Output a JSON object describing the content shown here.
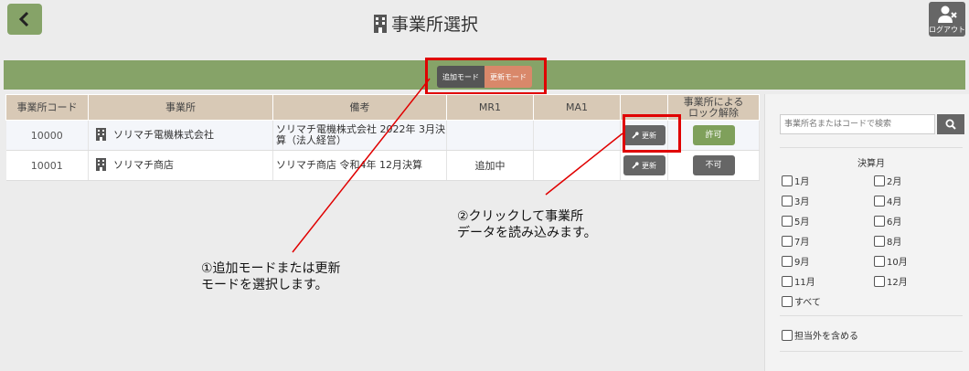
{
  "header": {
    "title": "事業所選択",
    "logout_label": "ログアウト"
  },
  "modes": {
    "add_label": "追加モード",
    "update_label": "更新モード"
  },
  "table": {
    "headers": [
      "事業所コード",
      "事業所",
      "備考",
      "MR1",
      "MA1",
      "",
      "事業所による\nロック解除"
    ],
    "rows": [
      {
        "code": "10000",
        "name": "ソリマチ電機株式会社",
        "note": "ソリマチ電機株式会社 2022年 3月決算（法人経営）",
        "mr1": "",
        "ma1": "",
        "update_label": "更新",
        "lock_label": "許可"
      },
      {
        "code": "10001",
        "name": "ソリマチ商店",
        "note": "ソリマチ商店 令和4年 12月決算",
        "mr1": "追加中",
        "ma1": "",
        "update_label": "更新",
        "lock_label": "不可"
      }
    ]
  },
  "sidebar": {
    "search_placeholder": "事業所名またはコードで検索",
    "fiscal_month_label": "決算月",
    "months": [
      "1月",
      "2月",
      "3月",
      "4月",
      "5月",
      "6月",
      "7月",
      "8月",
      "9月",
      "10月",
      "11月",
      "12月"
    ],
    "all_label": "すべて",
    "include_other_label": "担当外を含める"
  },
  "annotations": {
    "note1_line1": "①追加モードまたは更新",
    "note1_line2": "モードを選択します。",
    "note2_line1": "②クリックして事業所",
    "note2_line2": "データを読み込みます。"
  },
  "colors": {
    "accent_green": "#86a368",
    "highlight_red": "#e00000",
    "header_tan": "#d8c9b6",
    "update_mode": "#d9886a"
  }
}
